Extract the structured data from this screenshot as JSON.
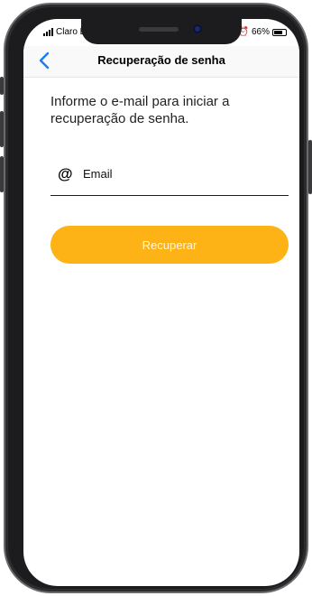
{
  "status_bar": {
    "carrier": "Claro BR",
    "battery": "66%"
  },
  "nav": {
    "title": "Recuperação de senha",
    "back_icon": "chevron-left-icon"
  },
  "instruction": "Informe o e-mail para iniciar a recuperação de senha.",
  "email_field": {
    "icon": "at-icon",
    "placeholder": "Email",
    "value": ""
  },
  "recover_button": {
    "label": "Recuperar"
  },
  "colors": {
    "accent": "#fdb215",
    "back_chevron": "#1a7cf0"
  }
}
